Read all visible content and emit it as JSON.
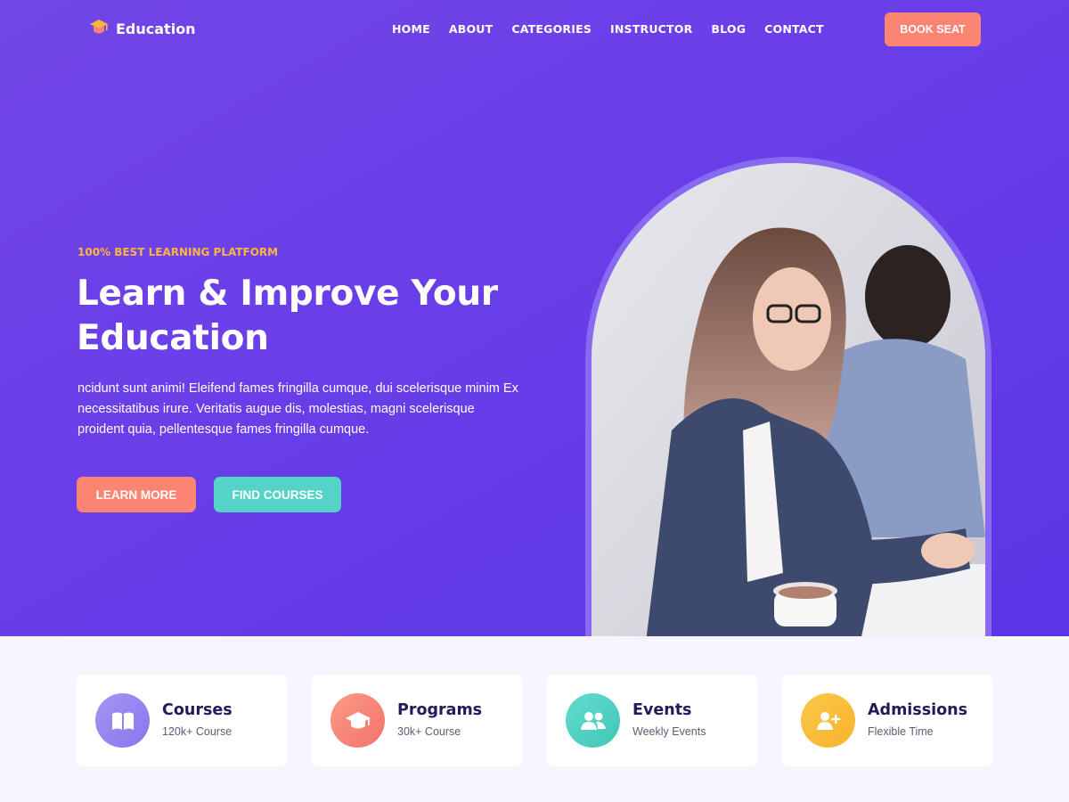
{
  "brand": {
    "name": "Education"
  },
  "nav": {
    "items": [
      "HOME",
      "ABOUT",
      "CATEGORIES",
      "INSTRUCTOR",
      "BLOG",
      "CONTACT"
    ],
    "cta": "BOOK SEAT"
  },
  "hero": {
    "eyebrow": "100% BEST LEARNING PLATFORM",
    "title_line1": "Learn & Improve Your",
    "title_line2": "Education",
    "description": "ncidunt sunt animi! Eleifend fames fringilla cumque, dui scelerisque minim Ex necessitatibus irure. Veritatis augue dis, molestias, magni scelerisque proident quia, pellentesque fames fringilla cumque.",
    "primary_button": "LEARN MORE",
    "secondary_button": "FIND COURSES"
  },
  "features": [
    {
      "title": "Courses",
      "subtitle": "120k+ Course",
      "icon": "book-icon",
      "color": "#9c86f0"
    },
    {
      "title": "Programs",
      "subtitle": "30k+ Course",
      "icon": "graduation-cap-icon",
      "color": "#f87e74"
    },
    {
      "title": "Events",
      "subtitle": "Weekly Events",
      "icon": "users-icon",
      "color": "#4ed0c2"
    },
    {
      "title": "Admissions",
      "subtitle": "Flexible Time",
      "icon": "user-plus-icon",
      "color": "#fbbe3a"
    }
  ],
  "colors": {
    "hero_bg": "#6a3fe8",
    "accent_coral": "#fc8473",
    "accent_teal": "#54d3c6",
    "eyebrow": "#fdb53f",
    "heading_dark": "#24195a"
  }
}
